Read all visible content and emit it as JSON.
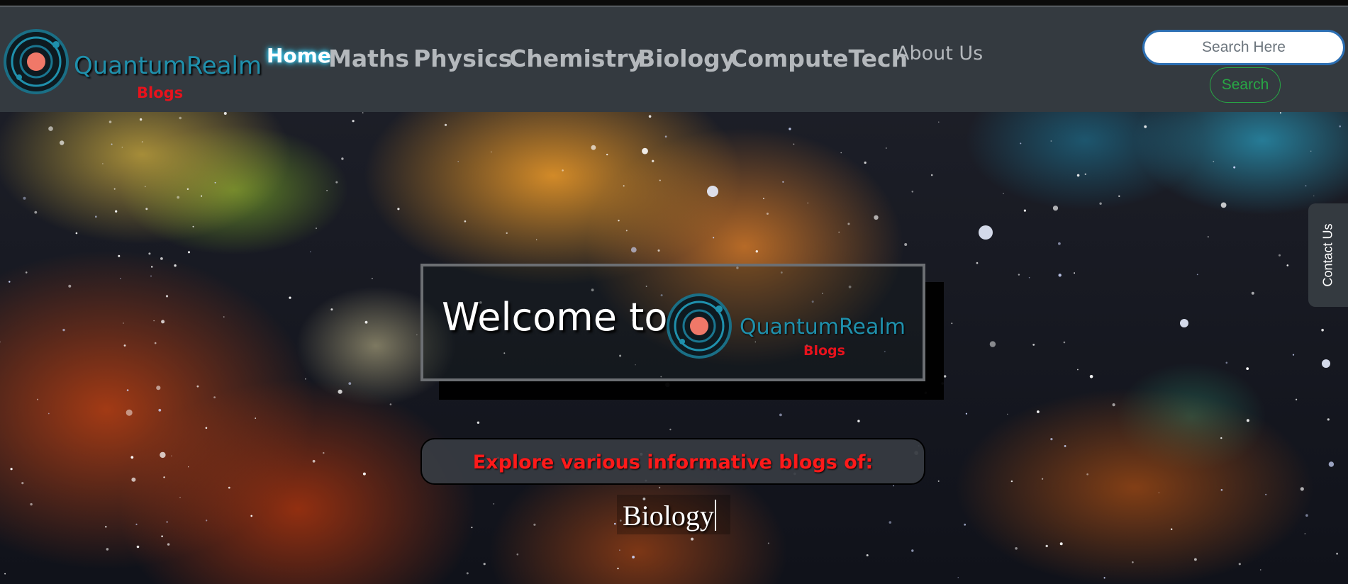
{
  "brand": {
    "name": "QuantumRealm",
    "subtitle": "Blogs",
    "logo_icon": "orbit-logo-icon"
  },
  "nav": {
    "items": [
      {
        "label": "Home",
        "active": true
      },
      {
        "label": "Maths"
      },
      {
        "label": "Physics"
      },
      {
        "label": "Chemistry"
      },
      {
        "label": "Biology"
      },
      {
        "label": "ComputeTech"
      },
      {
        "label": "About Us"
      }
    ]
  },
  "search": {
    "placeholder": "Search Here",
    "value": "",
    "button_label": "Search"
  },
  "hero": {
    "welcome_text": "Welcome to",
    "brand_name": "QuantumRealm",
    "brand_subtitle": "Blogs",
    "explore_text": "Explore various informative blogs of:",
    "typed_text": "Biology"
  },
  "contact_tab": {
    "label": "Contact Us"
  },
  "colors": {
    "navbar_bg": "#343a40",
    "brand_teal": "#1f90ac",
    "brand_red": "#e8121c",
    "search_green": "#28a745",
    "explore_red": "#ff1a1a"
  }
}
